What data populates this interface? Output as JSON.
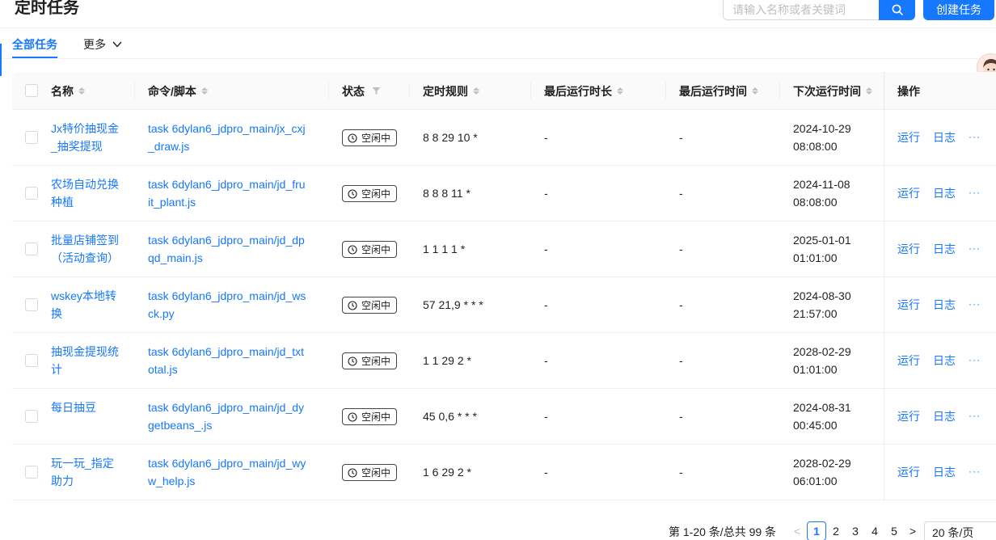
{
  "page": {
    "title": "定时任务"
  },
  "header": {
    "search_placeholder": "请输入名称或者关键词",
    "create_label": "创建任务"
  },
  "tabs": {
    "all": "全部任务",
    "more": "更多"
  },
  "table": {
    "columns": [
      "名称",
      "命令/脚本",
      "状态",
      "定时规则",
      "最后运行时长",
      "最后运行时间",
      "下次运行时间",
      "操作"
    ],
    "rows": [
      {
        "name": [
          "Jx特价抽现金",
          "_抽奖提现"
        ],
        "cmd": [
          "task 6dylan6_jdpro_main/jx_cxj",
          "_draw.js"
        ],
        "status": "空闲中",
        "cron": "8 8 29 10 *",
        "duration": "-",
        "last_run": "-",
        "next_run": [
          "2024-10-29",
          "08:08:00"
        ]
      },
      {
        "name": [
          "农场自动兑换",
          "种植"
        ],
        "cmd": [
          "task 6dylan6_jdpro_main/jd_fru",
          "it_plant.js"
        ],
        "status": "空闲中",
        "cron": "8 8 8 11 *",
        "duration": "-",
        "last_run": "-",
        "next_run": [
          "2024-11-08",
          "08:08:00"
        ]
      },
      {
        "name": [
          "批量店铺签到",
          "（活动查询）"
        ],
        "cmd": [
          "task 6dylan6_jdpro_main/jd_dp",
          "qd_main.js"
        ],
        "status": "空闲中",
        "cron": "1 1 1 1 *",
        "duration": "-",
        "last_run": "-",
        "next_run": [
          "2025-01-01",
          "01:01:00"
        ]
      },
      {
        "name": [
          "wskey本地转",
          "换"
        ],
        "cmd": [
          "task 6dylan6_jdpro_main/jd_ws",
          "ck.py"
        ],
        "status": "空闲中",
        "cron": "57 21,9 * * *",
        "duration": "-",
        "last_run": "-",
        "next_run": [
          "2024-08-30",
          "21:57:00"
        ]
      },
      {
        "name": [
          "抽现金提现统",
          "计"
        ],
        "cmd": [
          "task 6dylan6_jdpro_main/jd_txt",
          "otal.js"
        ],
        "status": "空闲中",
        "cron": "1 1 29 2 *",
        "duration": "-",
        "last_run": "-",
        "next_run": [
          "2028-02-29",
          "01:01:00"
        ]
      },
      {
        "name": [
          "每日抽豆",
          ""
        ],
        "cmd": [
          "task 6dylan6_jdpro_main/jd_dy",
          "getbeans_.js"
        ],
        "status": "空闲中",
        "cron": "45 0,6 * * *",
        "duration": "-",
        "last_run": "-",
        "next_run": [
          "2024-08-31",
          "00:45:00"
        ]
      },
      {
        "name": [
          "玩一玩_指定",
          "助力"
        ],
        "cmd": [
          "task 6dylan6_jdpro_main/jd_wy",
          "w_help.js"
        ],
        "status": "空闲中",
        "cron": "1 6 29 2 *",
        "duration": "-",
        "last_run": "-",
        "next_run": [
          "2028-02-29",
          "06:01:00"
        ]
      }
    ],
    "action_run": "运行",
    "action_log": "日志",
    "action_more": "···"
  },
  "pagination": {
    "total_text": "第 1-20 条/总共 99 条",
    "pages": [
      "1",
      "2",
      "3",
      "4",
      "5"
    ],
    "current": "1",
    "size_label": "20 条/页"
  },
  "colors": {
    "primary": "#1677ff",
    "header_bg": "#fafafa",
    "border": "#f0f0f0"
  },
  "icons": {
    "search": "search-icon",
    "chevron": "chevron-down-icon",
    "clock": "clock-icon",
    "filter": "filter-icon",
    "avatar": "avatar"
  }
}
